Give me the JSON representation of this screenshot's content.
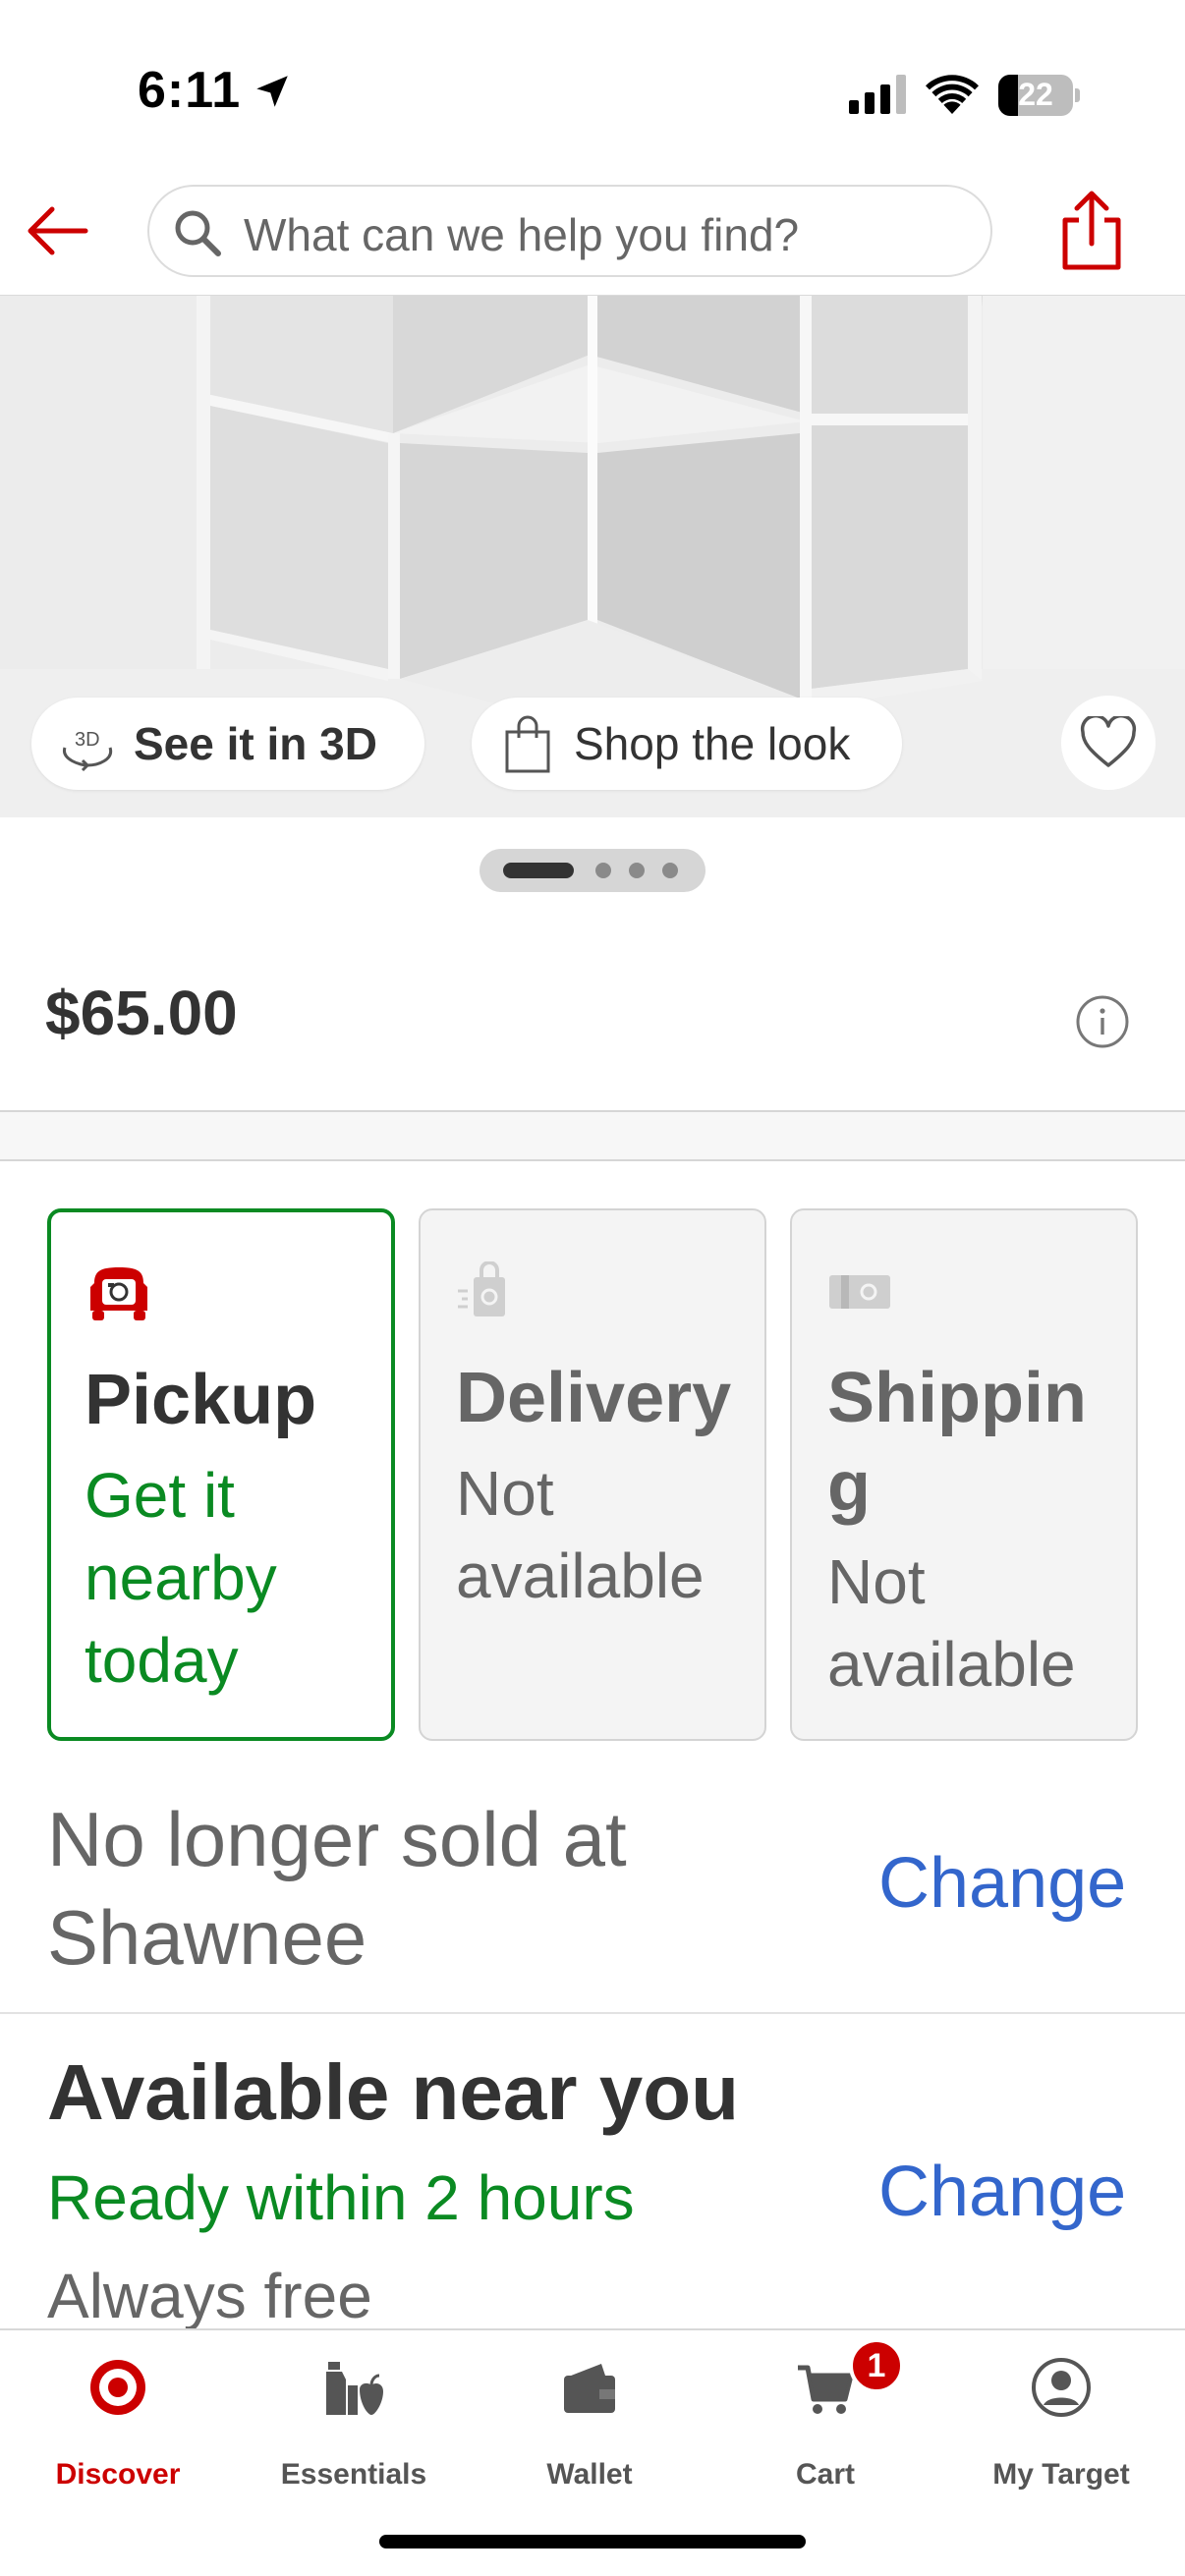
{
  "status_bar": {
    "time": "6:11",
    "battery": "22"
  },
  "header": {
    "search_placeholder": "What can we help you find?"
  },
  "hero": {
    "see_3d_label": "See it in 3D",
    "shop_look_label": "Shop the look",
    "carousel": {
      "total": 4,
      "active": 1
    }
  },
  "product": {
    "price": "$65.00"
  },
  "fulfillment": {
    "pickup": {
      "title": "Pickup",
      "status": "Get it nearby today"
    },
    "delivery": {
      "title": "Delivery",
      "status": "Not available"
    },
    "shipping": {
      "title": "Shippin g",
      "status": "Not available"
    }
  },
  "store": {
    "message": "No longer sold at Shawnee",
    "change_label": "Change"
  },
  "nearby": {
    "title": "Available near you",
    "ready": "Ready within 2 hours",
    "cost": "Always free",
    "change_label": "Change"
  },
  "tabbar": {
    "tabs": [
      {
        "label": "Discover"
      },
      {
        "label": "Essentials"
      },
      {
        "label": "Wallet"
      },
      {
        "label": "Cart"
      },
      {
        "label": "My Target"
      }
    ],
    "cart_badge": "1"
  },
  "colors": {
    "brand_red": "#cc0000",
    "success_green": "#0a8a22",
    "link_blue": "#3366cc"
  }
}
